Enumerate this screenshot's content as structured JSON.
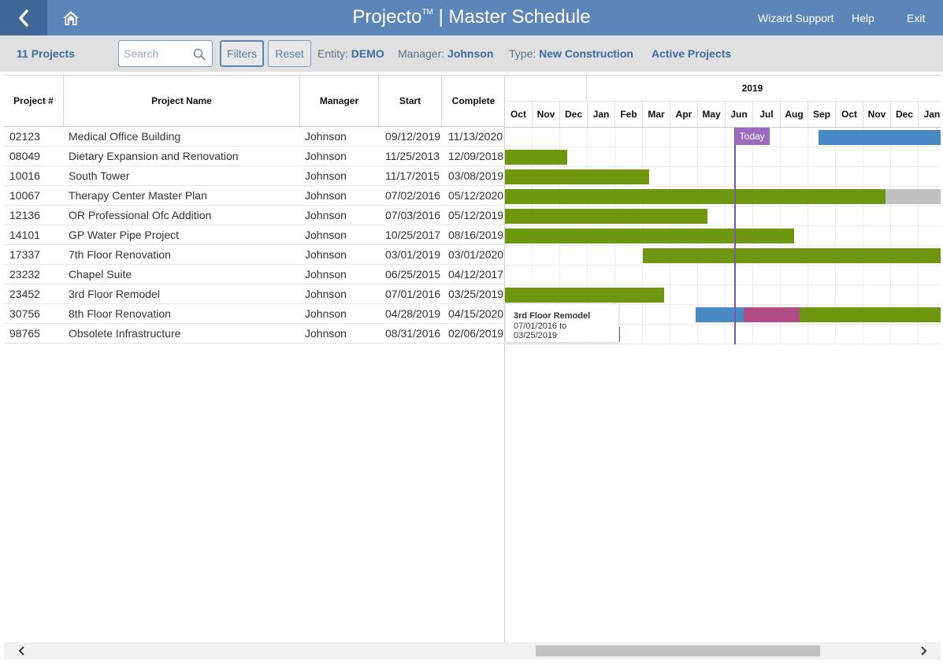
{
  "header": {
    "title": "Projecto",
    "trademark": "TM",
    "subtitle": "| Master Schedule",
    "nav": [
      "Wizard Support",
      "Help",
      "Exit"
    ]
  },
  "toolbar": {
    "project_count": "11 Projects",
    "search_placeholder": "Search",
    "filters_label": "Filters",
    "reset_label": "Reset",
    "entity_label": "Entity:",
    "entity_value": "DEMO",
    "manager_label": "Manager:",
    "manager_value": "Johnson",
    "type_label": "Type:",
    "type_value": "New Construction",
    "status_filter": "Active Projects"
  },
  "table": {
    "columns": [
      "Project #",
      "Project Name",
      "Manager",
      "Start",
      "Complete"
    ],
    "rows": [
      {
        "num": "02123",
        "name": "Medical Office Building",
        "manager": "Johnson",
        "start": "09/12/2019",
        "complete": "11/13/2020"
      },
      {
        "num": "08049",
        "name": "Dietary Expansion and Renovation",
        "manager": "Johnson",
        "start": "11/25/2013",
        "complete": "12/09/2018"
      },
      {
        "num": "10016",
        "name": "South Tower",
        "manager": "Johnson",
        "start": "11/17/2015",
        "complete": "03/08/2019"
      },
      {
        "num": "10067",
        "name": "Therapy Center Master Plan",
        "manager": "Johnson",
        "start": "07/02/2016",
        "complete": "05/12/2020"
      },
      {
        "num": "12136",
        "name": "OR Professional Ofc Addition",
        "manager": "Johnson",
        "start": "07/03/2016",
        "complete": "05/12/2019"
      },
      {
        "num": "14101",
        "name": "GP Water Pipe Project",
        "manager": "Johnson",
        "start": "10/25/2017",
        "complete": "08/16/2019"
      },
      {
        "num": "17337",
        "name": "7th Floor Renovation",
        "manager": "Johnson",
        "start": "03/01/2019",
        "complete": "03/01/2020"
      },
      {
        "num": "23232",
        "name": "Chapel Suite",
        "manager": "Johnson",
        "start": "06/25/2015",
        "complete": "04/12/2017"
      },
      {
        "num": "23452",
        "name": "3rd Floor Remodel",
        "manager": "Johnson",
        "start": "07/01/2016",
        "complete": "03/25/2019"
      },
      {
        "num": "30756",
        "name": "8th Floor Renovation",
        "manager": "Johnson",
        "start": "04/28/2019",
        "complete": "04/15/2020"
      },
      {
        "num": "98765",
        "name": "Obsolete Infrastructure",
        "manager": "Johnson",
        "start": "08/31/2016",
        "complete": "02/06/2019"
      }
    ]
  },
  "gantt": {
    "year_label": "2019",
    "months": [
      "Oct",
      "Nov",
      "Dec",
      "Jan",
      "Feb",
      "Mar",
      "Apr",
      "May",
      "Jun",
      "Jul",
      "Aug",
      "Sep",
      "Oct",
      "Nov",
      "Dec",
      "Jan"
    ],
    "visible_start": "2018-10-01",
    "today": "2019-06-11",
    "today_label": "Today",
    "colors": {
      "green": "#6e960e",
      "blue": "#4a8ac4",
      "gray": "#c0c0c0",
      "magenta": "#b04c86",
      "purple": "#7b59a6",
      "badge": "#9b6bbd"
    },
    "segments": [
      [
        {
          "from": "2019-09-12",
          "to": "2020-11-13",
          "color": "blue"
        }
      ],
      [
        {
          "from": "2013-11-25",
          "to": "2018-12-09",
          "color": "green"
        }
      ],
      [
        {
          "from": "2015-11-17",
          "to": "2019-03-08",
          "color": "green"
        }
      ],
      [
        {
          "from": "2016-07-02",
          "to": "2019-11-25",
          "color": "green"
        },
        {
          "from": "2019-11-25",
          "to": "2020-05-12",
          "color": "gray"
        }
      ],
      [
        {
          "from": "2016-07-03",
          "to": "2019-05-12",
          "color": "green"
        }
      ],
      [
        {
          "from": "2017-10-25",
          "to": "2019-08-16",
          "color": "green"
        }
      ],
      [
        {
          "from": "2019-03-01",
          "to": "2020-03-01",
          "color": "green"
        }
      ],
      [],
      [
        {
          "from": "2016-07-01",
          "to": "2019-03-25",
          "color": "green"
        }
      ],
      [
        {
          "from": "2019-04-28",
          "to": "2019-06-21",
          "color": "blue"
        },
        {
          "from": "2019-06-21",
          "to": "2019-08-22",
          "color": "magenta"
        },
        {
          "from": "2019-08-22",
          "to": "2020-04-15",
          "color": "green"
        }
      ],
      [
        {
          "from": "2016-08-31",
          "to": "2019-02-06",
          "color": "magenta"
        }
      ]
    ],
    "tooltip": {
      "title": "3rd Floor Remodel",
      "range": "07/01/2016 to 03/25/2019"
    }
  }
}
